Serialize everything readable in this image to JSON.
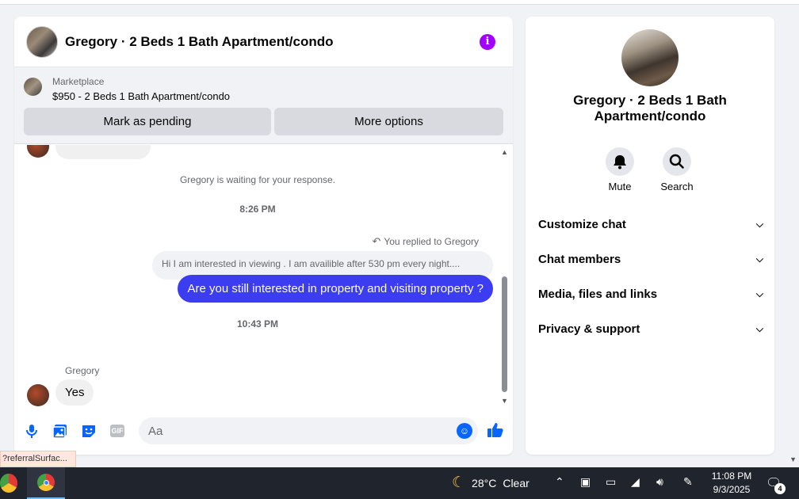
{
  "chat": {
    "title": "Gregory · 2 Beds 1 Bath Apartment/condo",
    "marketplace": {
      "label": "Marketplace",
      "listing": "$950 - 2 Beds 1 Bath Apartment/condo",
      "pending_button": "Mark as pending",
      "more_button": "More options"
    },
    "waiting_notice": "Gregory is waiting for your response.",
    "timestamp_1": "8:26 PM",
    "replied_label": "You replied to Gregory",
    "quoted_message": "Hi I am interested in viewing . I am availible after 530 pm every night....",
    "sent_message": "Are you still interested in property and visiting property ?",
    "timestamp_2": "10:43 PM",
    "sender_name": "Gregory",
    "received_message": "Yes",
    "composer_placeholder": "Aa"
  },
  "side": {
    "title": "Gregory · 2 Beds 1 Bath Apartment/condo",
    "mute_label": "Mute",
    "search_label": "Search",
    "rows": [
      {
        "label": "Customize chat"
      },
      {
        "label": "Chat members"
      },
      {
        "label": "Media, files and links"
      },
      {
        "label": "Privacy & support"
      }
    ]
  },
  "tooltip": "?referralSurfac...",
  "taskbar": {
    "temperature": "28°C",
    "weather": "Clear",
    "time": "11:08 PM",
    "date": "9/3/2025",
    "notification_count": "4"
  },
  "colors": {
    "accent": "#0866ff",
    "sent_bubble": "#3c3cf0",
    "info": "#a100ff"
  }
}
